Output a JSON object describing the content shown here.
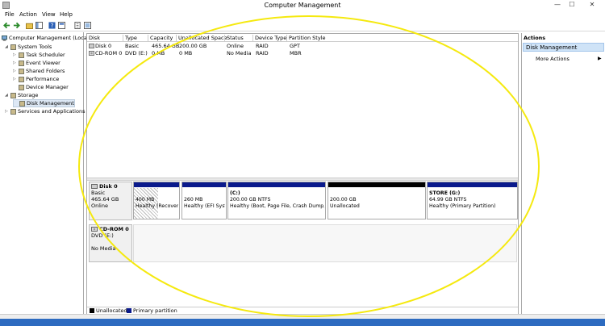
{
  "window": {
    "title": "Computer Management"
  },
  "menu": [
    "File",
    "Action",
    "View",
    "Help"
  ],
  "toolbar": {
    "icons": [
      "back-arrow-icon",
      "forward-arrow-icon",
      "folder-up-icon",
      "show-hide-tree-icon",
      "help-icon",
      "properties-icon",
      "export-icon",
      "mmc-icon"
    ]
  },
  "tree": {
    "root": "Computer Management (Local",
    "items": [
      {
        "label": "System Tools",
        "level": 1,
        "icon": "tools-icon",
        "expander": "◢"
      },
      {
        "label": "Task Scheduler",
        "level": 2,
        "icon": "clock-icon",
        "expander": "▷"
      },
      {
        "label": "Event Viewer",
        "level": 2,
        "icon": "event-viewer-icon",
        "expander": "▷"
      },
      {
        "label": "Shared Folders",
        "level": 2,
        "icon": "folder-icon",
        "expander": "▷"
      },
      {
        "label": "Performance",
        "level": 2,
        "icon": "performance-icon",
        "expander": "▷"
      },
      {
        "label": "Device Manager",
        "level": 2,
        "icon": "device-manager-icon",
        "expander": ""
      },
      {
        "label": "Storage",
        "level": 1,
        "icon": "storage-icon",
        "expander": "◢"
      },
      {
        "label": "Disk Management",
        "level": 2,
        "icon": "disk-icon",
        "expander": ""
      },
      {
        "label": "Services and Applications",
        "level": 1,
        "icon": "services-icon",
        "expander": "▷"
      }
    ]
  },
  "volume_list": {
    "columns": [
      "Disk",
      "Type",
      "Capacity",
      "Unallocated Space",
      "Status",
      "Device Type",
      "Partition Style"
    ],
    "rows": [
      [
        "Disk 0",
        "Basic",
        "465.64 GB",
        "200.00 GB",
        "Online",
        "RAID",
        "GPT"
      ],
      [
        "CD-ROM 0",
        "DVD (E:)",
        "0 MB",
        "0 MB",
        "No Media",
        "RAID",
        "MBR"
      ]
    ]
  },
  "graphical": {
    "disk0": {
      "name": "Disk 0",
      "type": "Basic",
      "size": "465.64 GB",
      "status": "Online"
    },
    "partitions": [
      {
        "line1": "",
        "line2": "400 MB",
        "line3": "Healthy (Recovery",
        "bar": "#0a1a8c",
        "hatched": true
      },
      {
        "line1": "",
        "line2": "260 MB",
        "line3": "Healthy (EFI Syst",
        "bar": "#0a1a8c",
        "hatched": false
      },
      {
        "line1": "(C:)",
        "line2": "200.00 GB NTFS",
        "line3": "Healthy (Boot, Page File, Crash Dump, F",
        "bar": "#0a1a8c",
        "hatched": false
      },
      {
        "line1": "",
        "line2": "200.00 GB",
        "line3": "Unallocated",
        "bar": "#000000",
        "hatched": false
      },
      {
        "line1": "STORE (G:)",
        "line2": "64.99 GB NTFS",
        "line3": "Healthy (Primary Partition)",
        "bar": "#0a1a8c",
        "hatched": false
      }
    ],
    "cdrom": {
      "name": "CD-ROM 0",
      "type": "DVD (E:)",
      "media": "No Media"
    }
  },
  "legend": [
    {
      "label": "Unallocated",
      "color": "#000000"
    },
    {
      "label": "Primary partition",
      "color": "#0a1a8c"
    }
  ],
  "actions": {
    "header": "Actions",
    "selected": "Disk Management",
    "more": "More Actions"
  },
  "colors": {
    "highlight_ellipse": "#f5e90f",
    "taskbar": "#2d6bc0",
    "selected_bg": "#cfe3f7"
  }
}
